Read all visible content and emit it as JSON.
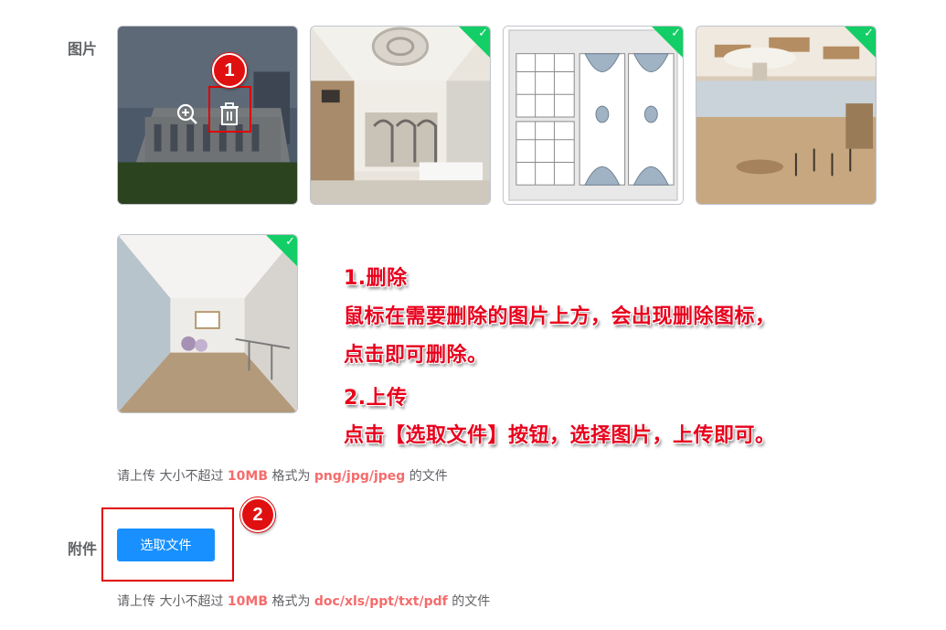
{
  "form": {
    "image_label": "图片",
    "attachment_label": "附件"
  },
  "images": [
    {
      "name": "building-exterior",
      "hovered": true
    },
    {
      "name": "lobby-turnstiles",
      "checked": true
    },
    {
      "name": "court-floorplan",
      "checked": true
    },
    {
      "name": "tree-lounge",
      "checked": true
    },
    {
      "name": "dance-studio",
      "checked": true
    }
  ],
  "image_tip": {
    "prefix": "请上传 大小不超过",
    "size": "10MB",
    "mid": "格式为",
    "formats": "png/jpg/jpeg",
    "suffix": "的文件"
  },
  "attachment_tip": {
    "prefix": "请上传 大小不超过",
    "size": "10MB",
    "mid": "格式为",
    "formats": "doc/xls/ppt/txt/pdf",
    "suffix": "的文件"
  },
  "upload_button": "选取文件",
  "badges": {
    "one": "1",
    "two": "2"
  },
  "annotation": {
    "line1": "1.删除",
    "line2": "鼠标在需要删除的图片上方，会出现删除图标，",
    "line3": "点击即可删除。",
    "line4": "2.上传",
    "line5": "点击【选取文件】按钮，选择图片，上传即可。"
  },
  "colors": {
    "accent": "#1890ff",
    "success": "#13ce66",
    "annotation": "#e8001c",
    "highlight": "#f56c6c"
  }
}
